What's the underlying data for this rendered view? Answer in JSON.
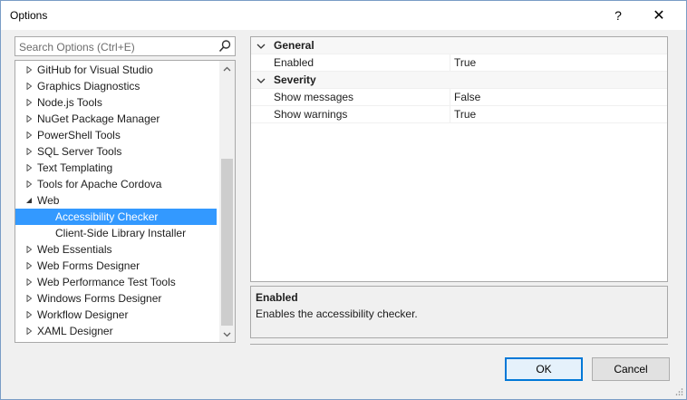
{
  "window": {
    "title": "Options",
    "help_label": "?",
    "close_label": "✕"
  },
  "search": {
    "placeholder": "Search Options (Ctrl+E)",
    "icon": "search-icon"
  },
  "tree": {
    "items": [
      {
        "label": "GitHub for Visual Studio",
        "expanded": false,
        "level": 0
      },
      {
        "label": "Graphics Diagnostics",
        "expanded": false,
        "level": 0
      },
      {
        "label": "Node.js Tools",
        "expanded": false,
        "level": 0
      },
      {
        "label": "NuGet Package Manager",
        "expanded": false,
        "level": 0
      },
      {
        "label": "PowerShell Tools",
        "expanded": false,
        "level": 0
      },
      {
        "label": "SQL Server Tools",
        "expanded": false,
        "level": 0
      },
      {
        "label": "Text Templating",
        "expanded": false,
        "level": 0
      },
      {
        "label": "Tools for Apache Cordova",
        "expanded": false,
        "level": 0
      },
      {
        "label": "Web",
        "expanded": true,
        "level": 0
      },
      {
        "label": "Accessibility Checker",
        "level": 1,
        "selected": true
      },
      {
        "label": "Client-Side Library Installer",
        "level": 1
      },
      {
        "label": "Web Essentials",
        "expanded": false,
        "level": 0
      },
      {
        "label": "Web Forms Designer",
        "expanded": false,
        "level": 0
      },
      {
        "label": "Web Performance Test Tools",
        "expanded": false,
        "level": 0
      },
      {
        "label": "Windows Forms Designer",
        "expanded": false,
        "level": 0
      },
      {
        "label": "Workflow Designer",
        "expanded": false,
        "level": 0
      },
      {
        "label": "XAML Designer",
        "expanded": false,
        "level": 0
      }
    ]
  },
  "grid": {
    "categories": [
      {
        "label": "General",
        "properties": [
          {
            "name": "Enabled",
            "value": "True"
          }
        ]
      },
      {
        "label": "Severity",
        "properties": [
          {
            "name": "Show messages",
            "value": "False"
          },
          {
            "name": "Show warnings",
            "value": "True"
          }
        ]
      }
    ]
  },
  "description": {
    "title": "Enabled",
    "text": "Enables the accessibility checker."
  },
  "buttons": {
    "ok": "OK",
    "cancel": "Cancel"
  },
  "colors": {
    "selection": "#3399ff",
    "ok_border": "#0078d7"
  }
}
